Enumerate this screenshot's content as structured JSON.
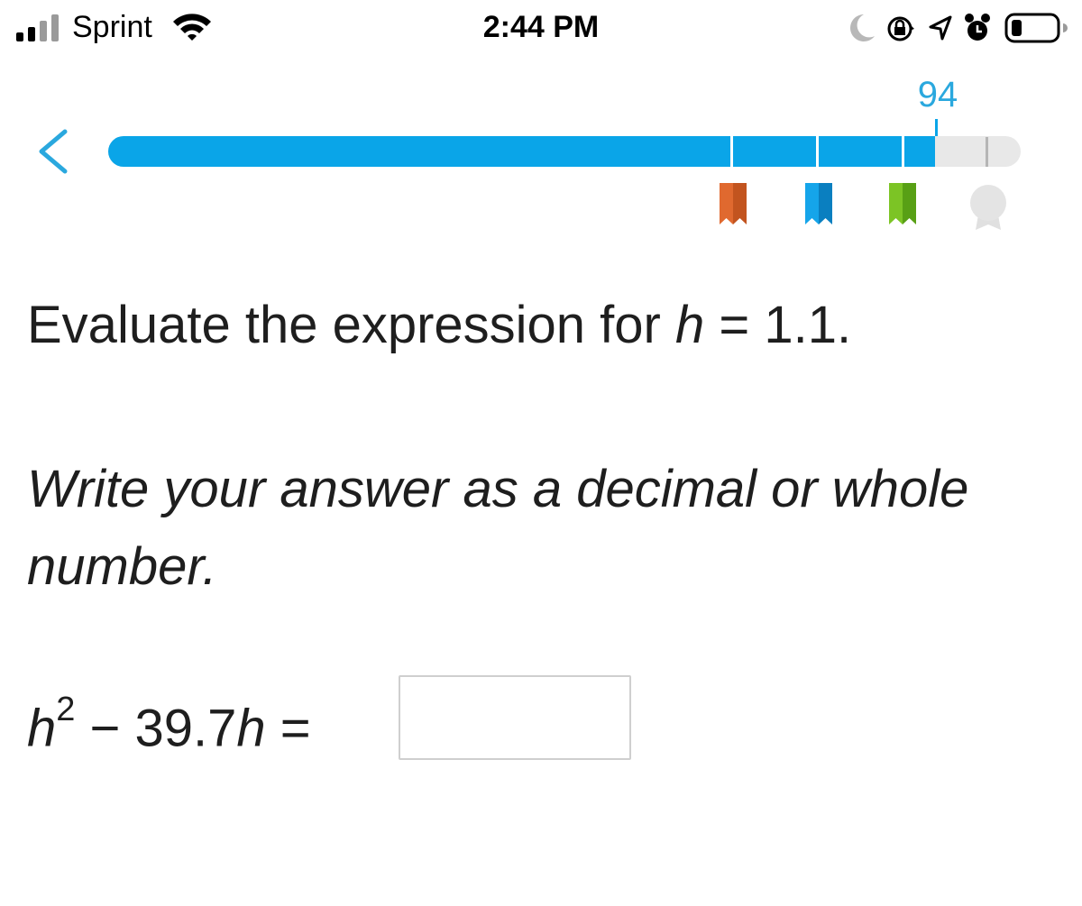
{
  "status_bar": {
    "carrier": "Sprint",
    "time": "2:44 PM",
    "icons": [
      "signal-icon",
      "wifi-icon",
      "moon-icon",
      "orientation-lock-icon",
      "location-arrow-icon",
      "alarm-icon",
      "battery-icon"
    ]
  },
  "progress": {
    "score": "94",
    "smartscore_fraction": 0.94,
    "max": 100,
    "milestones": [
      {
        "name": "ribbon-orange",
        "color": "#e0692f"
      },
      {
        "name": "ribbon-blue",
        "color": "#0a8fd2"
      },
      {
        "name": "ribbon-green",
        "color": "#6fb320"
      },
      {
        "name": "medal-gray",
        "color": "#e0e0e0"
      }
    ],
    "fill_color": "#0aa5e8",
    "track_color": "#e8e8e8"
  },
  "question": {
    "prompt_prefix": "Evaluate the expression for ",
    "variable": "h",
    "prompt_equals": " = 1.1.",
    "instruction": "Write your answer as a decimal or whole number.",
    "expression": {
      "base": "h",
      "exponent": "2",
      "middle": " − 39.7",
      "var2": "h",
      "equals": " ="
    },
    "answer_value": ""
  }
}
